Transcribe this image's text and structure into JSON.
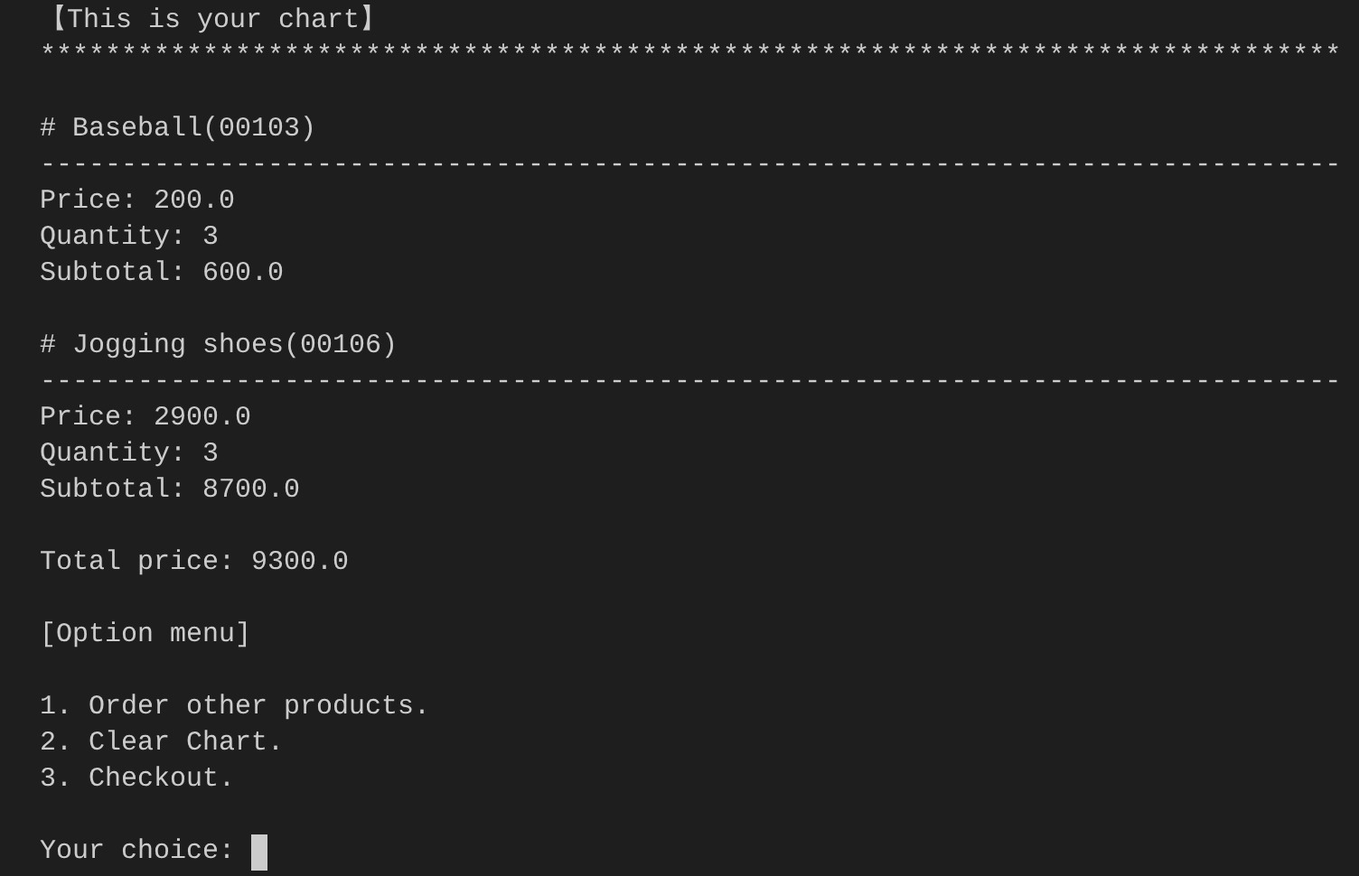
{
  "title": "【This is your chart】",
  "title_rule": "********************************************************************************",
  "items": [
    {
      "heading": "# Baseball(00103)",
      "rule": "--------------------------------------------------------------------------------",
      "lines": [
        "Price: 200.0",
        "Quantity: 3",
        "Subtotal: 600.0"
      ]
    },
    {
      "heading": "# Jogging shoes(00106)",
      "rule": "--------------------------------------------------------------------------------",
      "lines": [
        "Price: 2900.0",
        "Quantity: 3",
        "Subtotal: 8700.0"
      ]
    }
  ],
  "total": "Total price: 9300.0",
  "menu_heading": "[Option menu]",
  "options": [
    "1. Order other products.",
    "2. Clear Chart.",
    "3. Checkout."
  ],
  "prompt": "Your choice:"
}
